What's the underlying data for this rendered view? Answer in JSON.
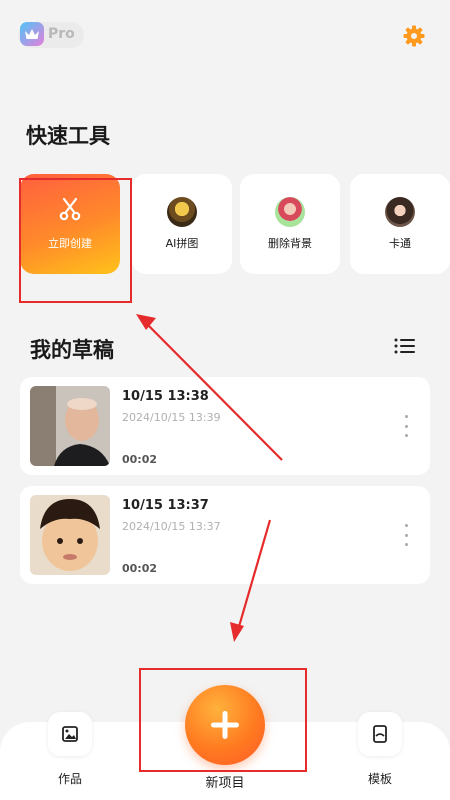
{
  "header": {
    "pro_label": "Pro",
    "logo_icon": "crown-icon",
    "settings_icon": "gear-icon",
    "accent": "#ff8a2a"
  },
  "quick_tools": {
    "title": "快速工具",
    "items": [
      {
        "label": "立即创建",
        "icon": "scissors-icon"
      },
      {
        "label": "AI拼图"
      },
      {
        "label": "删除背景"
      },
      {
        "label": "卡通"
      }
    ]
  },
  "drafts": {
    "title": "我的草稿",
    "list_icon": "list-view-icon",
    "items": [
      {
        "name": "10/15 13:38",
        "date": "2024/10/15 13:39",
        "duration": "00:02"
      },
      {
        "name": "10/15 13:37",
        "date": "2024/10/15 13:37",
        "duration": "00:02"
      }
    ]
  },
  "nav": {
    "works": "作品",
    "new_project": "新项目",
    "templates": "模板"
  }
}
